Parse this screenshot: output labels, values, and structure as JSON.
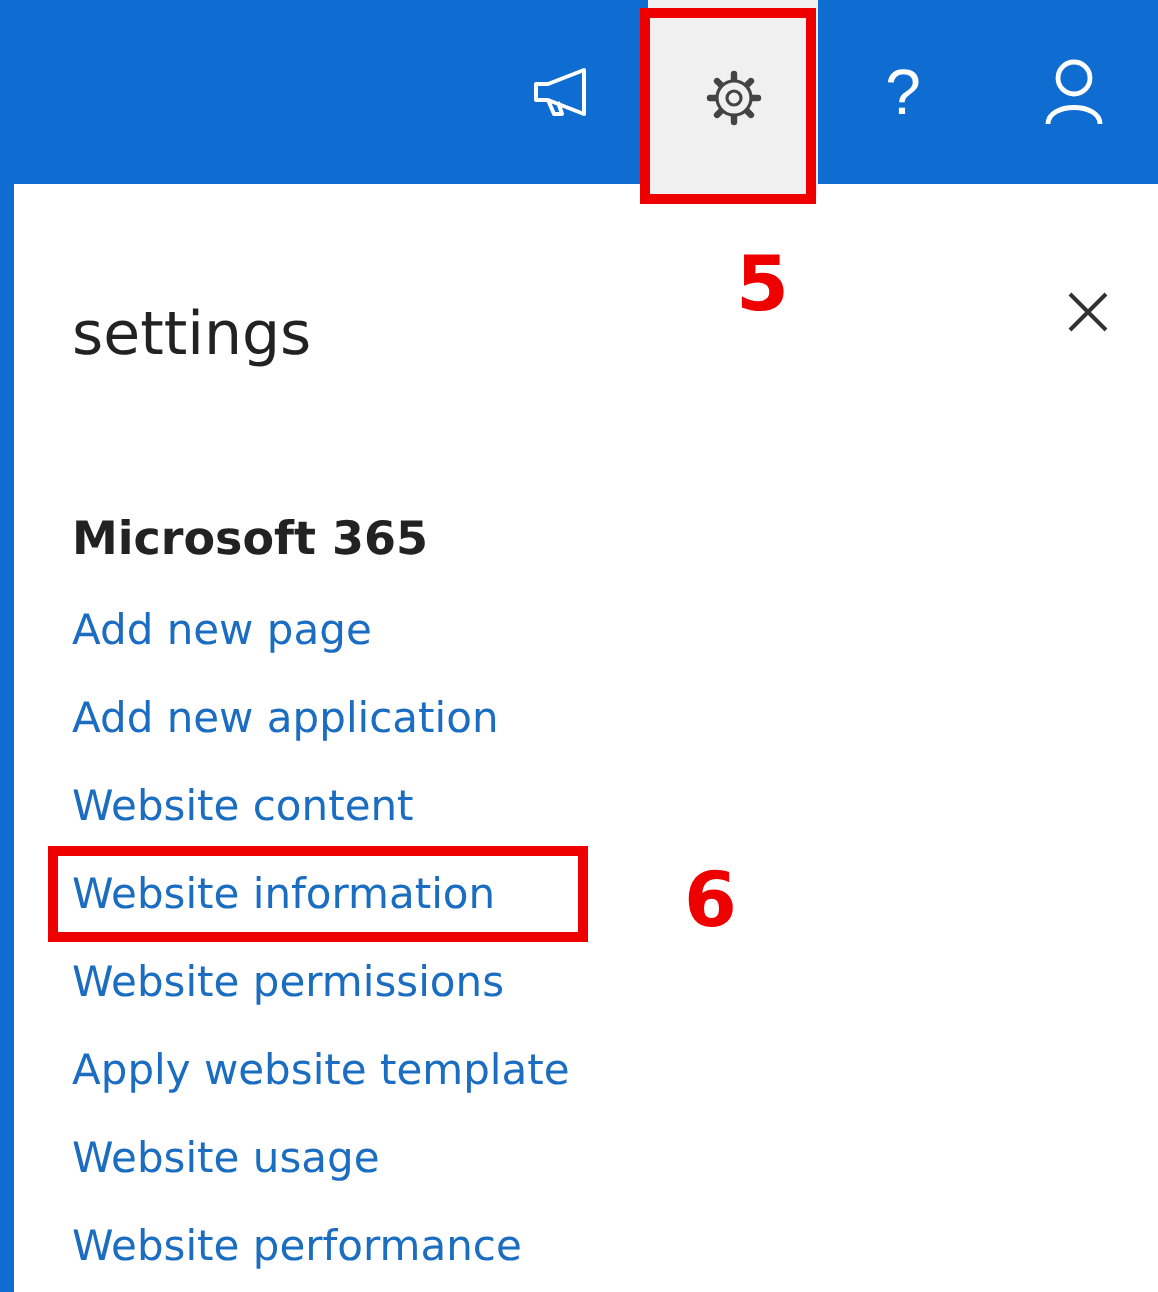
{
  "header": {
    "buttons": [
      {
        "kind": "megaphone",
        "selected": false
      },
      {
        "kind": "gear",
        "selected": true,
        "callout": "5"
      },
      {
        "kind": "help",
        "label": "?",
        "selected": false
      },
      {
        "kind": "person",
        "selected": false
      }
    ]
  },
  "panel": {
    "title": "settings",
    "section": "Microsoft 365",
    "links": [
      {
        "label": "Add new page"
      },
      {
        "label": "Add new application"
      },
      {
        "label": "Website content"
      },
      {
        "label": "Website information",
        "callout": "6"
      },
      {
        "label": "Website permissions"
      },
      {
        "label": "Apply website template"
      },
      {
        "label": "Website usage"
      },
      {
        "label": "Website performance"
      }
    ]
  }
}
